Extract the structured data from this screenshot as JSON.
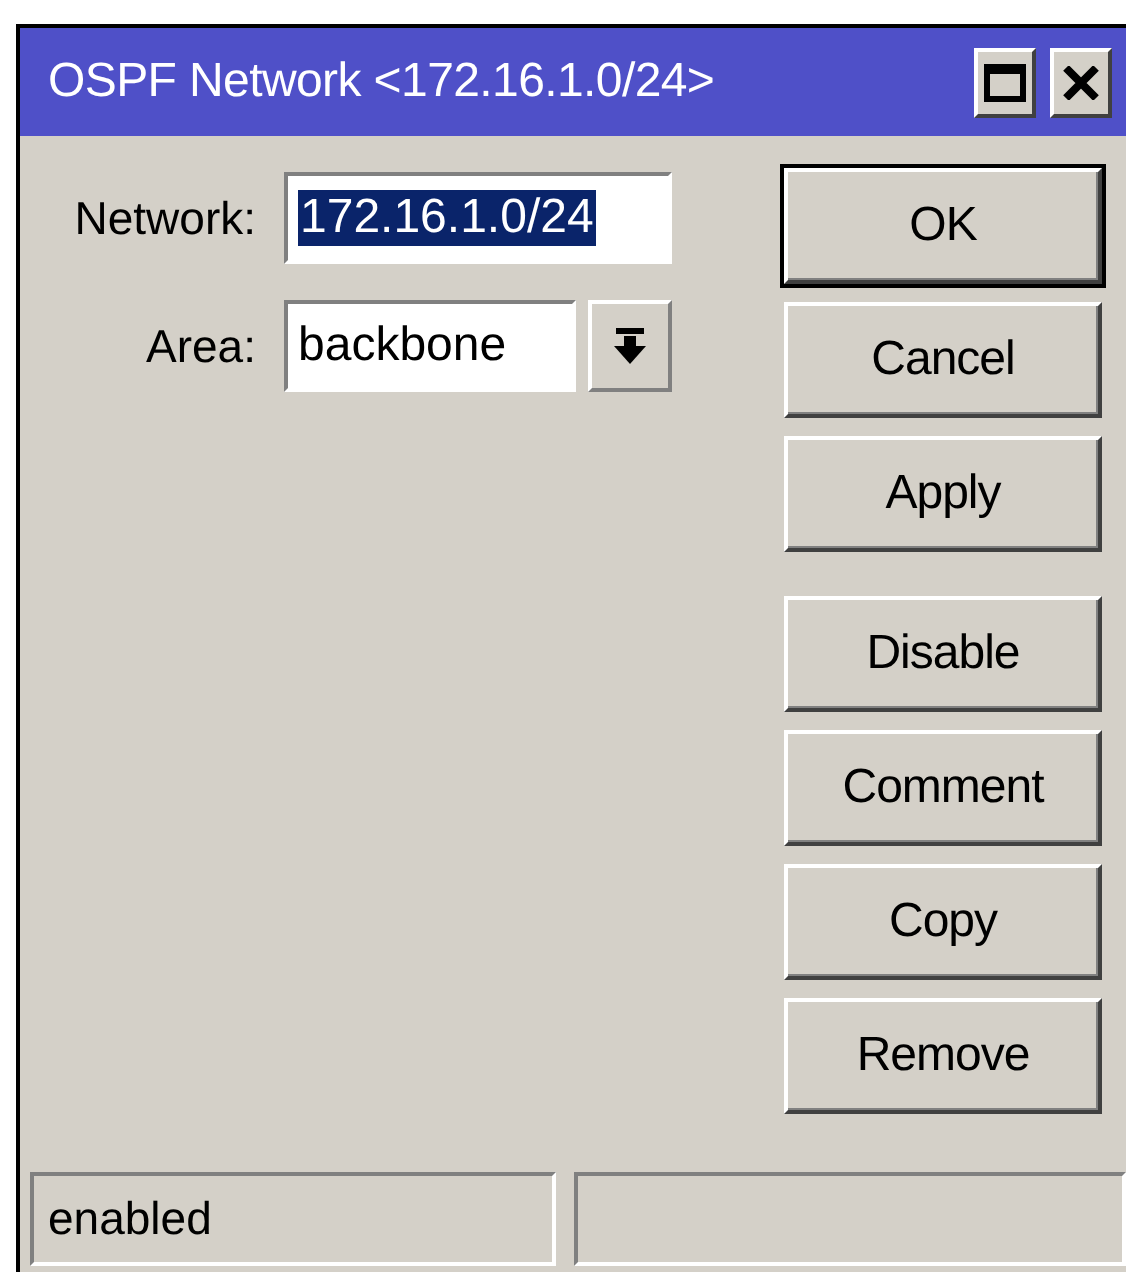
{
  "window": {
    "title": "OSPF Network <172.16.1.0/24>"
  },
  "fields": [
    {
      "kind": "text",
      "label": "Network:",
      "value": "172.16.1.0/24",
      "selected": true
    },
    {
      "kind": "dropdown",
      "label": "Area:",
      "value": "backbone",
      "selected": false
    }
  ],
  "button_groups": [
    {
      "buttons": [
        {
          "label": "OK",
          "default": true
        },
        {
          "label": "Cancel",
          "default": false
        },
        {
          "label": "Apply",
          "default": false
        }
      ]
    },
    {
      "buttons": [
        {
          "label": "Disable",
          "default": false
        },
        {
          "label": "Comment",
          "default": false
        },
        {
          "label": "Copy",
          "default": false
        },
        {
          "label": "Remove",
          "default": false
        }
      ]
    }
  ],
  "status_bar": {
    "status": "enabled"
  }
}
